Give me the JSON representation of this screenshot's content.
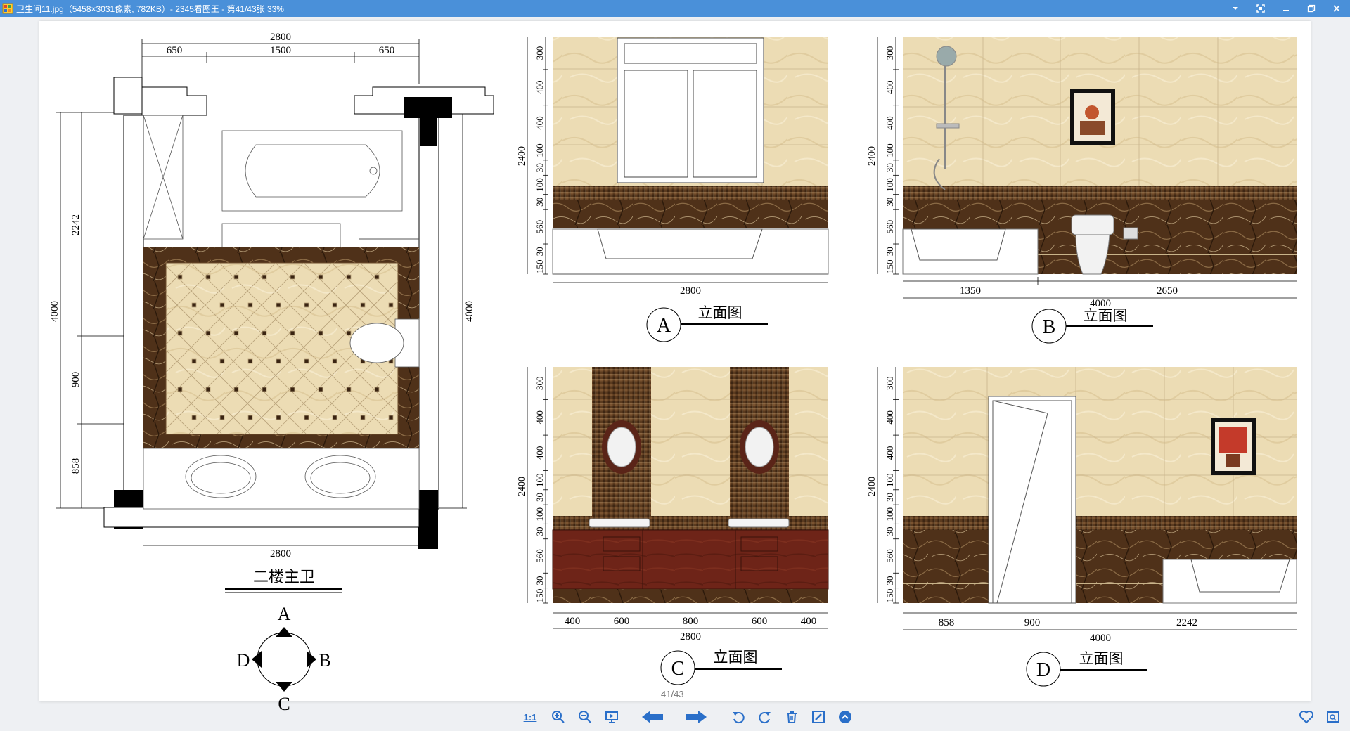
{
  "window": {
    "title": "卫生间11.jpg（5458×3031像素, 782KB）- 2345看图王 - 第41/43张 33%"
  },
  "viewer": {
    "page_indicator": "41/43",
    "toolbar": {
      "actual_size_label": "1:1"
    }
  },
  "plan": {
    "title": "二楼主卫",
    "dim_top_total": "2800",
    "dim_top_left": "650",
    "dim_top_mid": "1500",
    "dim_top_right": "650",
    "dim_bottom": "2800",
    "dim_left_total": "4000",
    "dim_left_a": "2242",
    "dim_left_b": "900",
    "dim_left_c": "858",
    "dim_right": "4000"
  },
  "compass": {
    "n": "A",
    "e": "B",
    "s": "C",
    "w": "D"
  },
  "elevations": {
    "a": {
      "label": "A",
      "title": "立面图",
      "v_dims": [
        "300",
        "400",
        "400",
        "100",
        "30",
        "100",
        "30",
        "560",
        "30",
        "150"
      ],
      "v_total": "2400",
      "h_dims": [],
      "h_total": "2800"
    },
    "b": {
      "label": "B",
      "title": "立面图",
      "v_dims": [
        "300",
        "400",
        "400",
        "100",
        "30",
        "100",
        "30",
        "560",
        "30",
        "150"
      ],
      "v_total": "2400",
      "h_dims": [
        "1350",
        "2650"
      ],
      "h_total": "4000"
    },
    "c": {
      "label": "C",
      "title": "立面图",
      "v_dims": [
        "300",
        "400",
        "400",
        "100",
        "30",
        "100",
        "30",
        "560",
        "30",
        "150"
      ],
      "v_total": "2400",
      "h_dims": [
        "400",
        "600",
        "800",
        "600",
        "400"
      ],
      "h_total": "2800"
    },
    "d": {
      "label": "D",
      "title": "立面图",
      "v_dims": [
        "300",
        "400",
        "400",
        "100",
        "30",
        "100",
        "30",
        "560",
        "30",
        "150"
      ],
      "v_total": "2400",
      "h_dims": [
        "858",
        "900",
        "2242"
      ],
      "h_total": "4000"
    }
  },
  "colors": {
    "titlebar": "#4a90d9",
    "tile_cream": "#eedfb8",
    "marble_brown": "#5a3a1e",
    "cabinet_red": "#6e2418",
    "toolbar_blue": "#2a6fc9"
  }
}
